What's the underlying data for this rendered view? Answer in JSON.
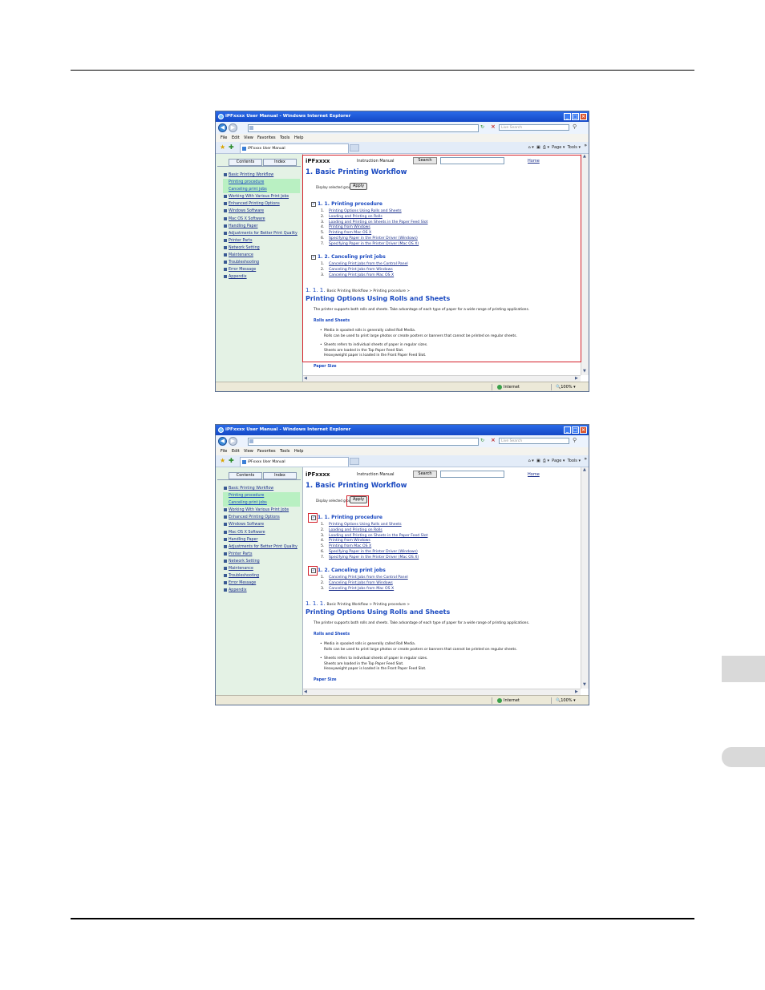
{
  "window": {
    "title": "iPFxxxx User Manual - Windows Internet Explorer",
    "search_placeholder": "Live Search",
    "tab_label": "iPFxxxx User Manual"
  },
  "menu": [
    "File",
    "Edit",
    "View",
    "Favorites",
    "Tools",
    "Help"
  ],
  "toolbar": {
    "page_label": "Page",
    "tools_label": "Tools"
  },
  "nav": {
    "contents_tab": "Contents",
    "index_tab": "Index",
    "items": [
      {
        "label": "Basic Printing Workflow",
        "sub": false
      },
      {
        "label": "Printing procedure",
        "sub": true
      },
      {
        "label": "Canceling print jobs",
        "sub": true
      },
      {
        "label": "Working With Various Print Jobs",
        "sub": false
      },
      {
        "label": "Enhanced Printing Options",
        "sub": false
      },
      {
        "label": "Windows Software",
        "sub": false
      },
      {
        "label": "Mac OS X Software",
        "sub": false
      },
      {
        "label": "Handling Paper",
        "sub": false
      },
      {
        "label": "Adjustments for Better Print Quality",
        "sub": false
      },
      {
        "label": "Printer Parts",
        "sub": false
      },
      {
        "label": "Network Setting",
        "sub": false
      },
      {
        "label": "Maintenance",
        "sub": false
      },
      {
        "label": "Troubleshooting",
        "sub": false
      },
      {
        "label": "Error Message",
        "sub": false
      },
      {
        "label": "Appendix",
        "sub": false
      }
    ]
  },
  "header": {
    "brand": "iPFxxxx",
    "subtitle": "Instruction Manual",
    "search_button": "Search",
    "home_link": "Home"
  },
  "doc": {
    "title": "1. Basic Printing Workflow",
    "display_label": "Display selected groups",
    "apply_button": "Apply",
    "section1": {
      "title": "1. 1. Printing procedure",
      "items": [
        "Printing Options Using Rolls and Sheets",
        "Loading and Printing on Rolls",
        "Loading and Printing on Sheets in the Paper Feed Slot",
        "Printing from Windows",
        "Printing from Mac OS X",
        "Specifying Paper in the Printer Driver (Windows)",
        "Specifying Paper in the Printer Driver (Mac OS X)"
      ]
    },
    "section2": {
      "title": "1. 2. Canceling print jobs",
      "items": [
        "Canceling Print Jobs from the Control Panel",
        "Canceling Print Jobs from Windows",
        "Canceling Print Jobs from Mac OS X"
      ]
    },
    "section_number": "1. 1. 1.",
    "breadcrumb": "Basic Printing Workflow > Printing procedure >",
    "h2": "Printing Options Using Rolls and Sheets",
    "intro": "The printer supports both rolls and sheets. Take advantage of each type of paper for a wide range of printing applications.",
    "rolls_heading": "Rolls and Sheets",
    "bullet1": [
      "Media in spooled rolls is generally called Roll Media.",
      "Rolls can be used to print large photos or create posters or banners that cannot be printed on regular sheets."
    ],
    "bullet2": [
      "Sheets refers to individual sheets of paper in regular sizes.",
      "Sheets are loaded in the Top Paper Feed Slot.",
      "Heavyweight paper is loaded in the Front Paper Feed Slot."
    ],
    "paper_size_heading": "Paper Size"
  },
  "status": {
    "zone": "Internet",
    "zoom": "100%"
  }
}
